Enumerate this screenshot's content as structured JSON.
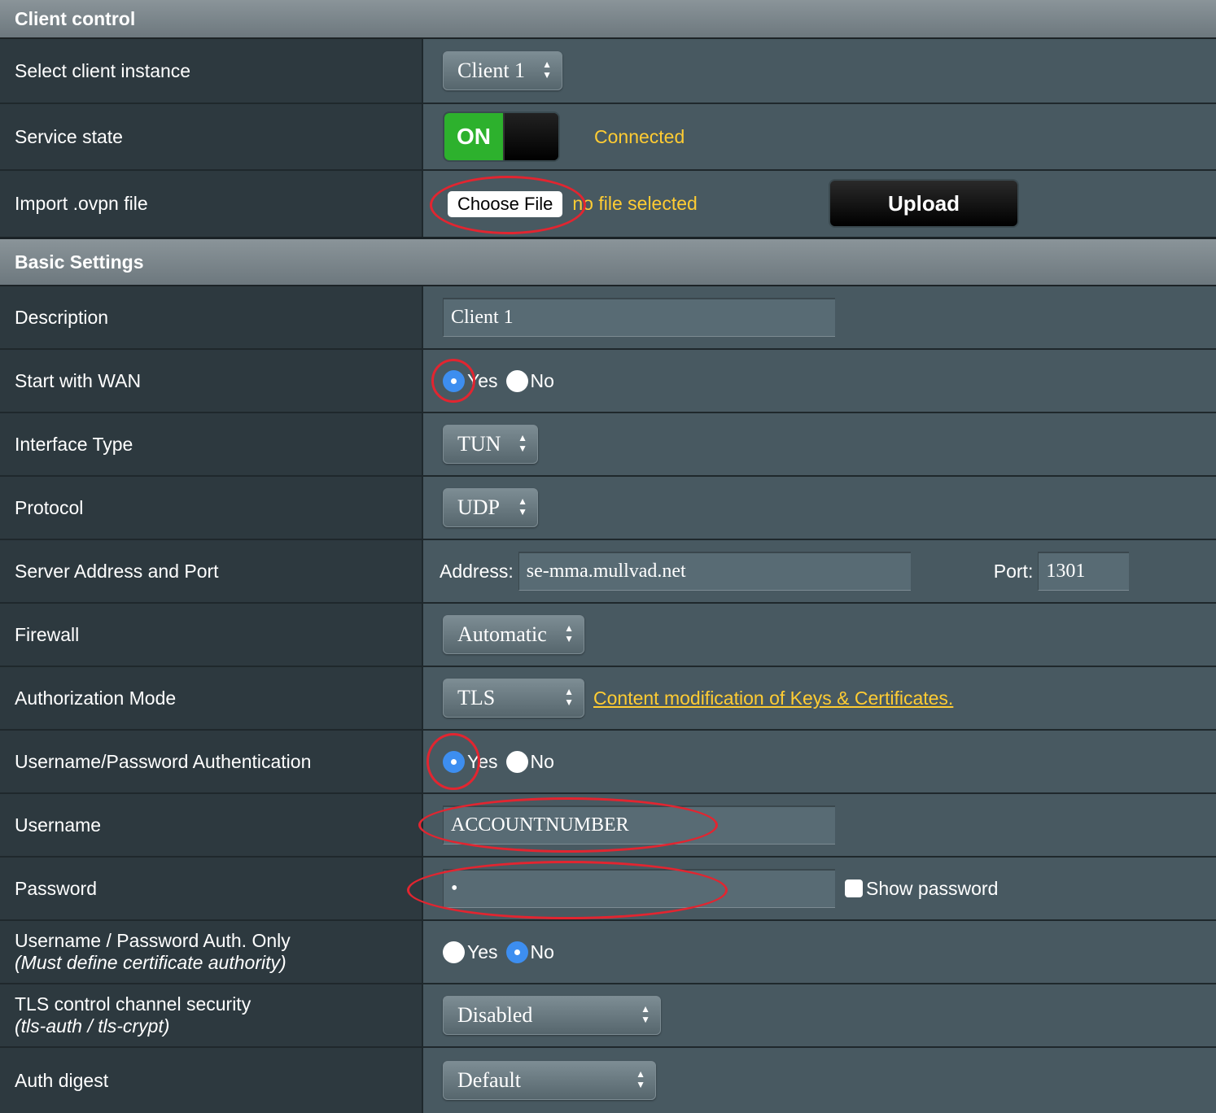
{
  "client_control": {
    "header": "Client control",
    "select_client": {
      "label": "Select client instance",
      "value": "Client 1"
    },
    "service_state": {
      "label": "Service state",
      "toggle": "ON",
      "status": "Connected"
    },
    "import_file": {
      "label": "Import .ovpn file",
      "choose_label": "Choose File",
      "file_status": "no file selected",
      "upload_label": "Upload"
    }
  },
  "basic_settings": {
    "header": "Basic Settings",
    "description": {
      "label": "Description",
      "value": "Client 1"
    },
    "start_with_wan": {
      "label": "Start with WAN",
      "yes": "Yes",
      "no": "No",
      "selected": "Yes"
    },
    "interface_type": {
      "label": "Interface Type",
      "value": "TUN"
    },
    "protocol": {
      "label": "Protocol",
      "value": "UDP"
    },
    "server": {
      "label": "Server Address and Port",
      "address_label": "Address:",
      "address": "se-mma.mullvad.net",
      "port_label": "Port:",
      "port": "1301"
    },
    "firewall": {
      "label": "Firewall",
      "value": "Automatic"
    },
    "auth_mode": {
      "label": "Authorization Mode",
      "value": "TLS",
      "link": "Content modification of Keys & Certificates."
    },
    "userpass_auth": {
      "label": "Username/Password Authentication",
      "yes": "Yes",
      "no": "No",
      "selected": "Yes"
    },
    "username": {
      "label": "Username",
      "value": "ACCOUNTNUMBER"
    },
    "password": {
      "label": "Password",
      "value": "•",
      "show_label": "Show password"
    },
    "userpass_only": {
      "label": "Username / Password Auth. Only",
      "sublabel": "(Must define certificate authority)",
      "yes": "Yes",
      "no": "No",
      "selected": "No"
    },
    "tls_control": {
      "label": "TLS control channel security",
      "sublabel": "(tls-auth / tls-crypt)",
      "value": "Disabled"
    },
    "auth_digest": {
      "label": "Auth digest",
      "value": "Default"
    }
  },
  "colors": {
    "annotation_circle": "#e22530",
    "accent_yellow": "#ffcc33",
    "radio_selected": "#3d8ef0",
    "toggle_on": "#2db12d"
  }
}
